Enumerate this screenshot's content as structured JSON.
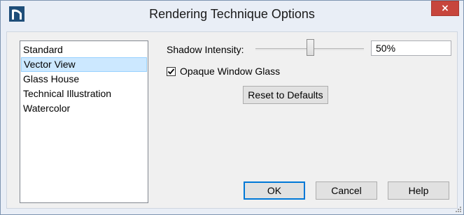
{
  "window": {
    "title": "Rendering Technique Options",
    "close_label": "×",
    "accent_color": "#1f4e79"
  },
  "technique_list": {
    "items": [
      {
        "label": "Standard",
        "selected": false
      },
      {
        "label": "Vector View",
        "selected": true
      },
      {
        "label": "Glass House",
        "selected": false
      },
      {
        "label": "Technical Illustration",
        "selected": false
      },
      {
        "label": "Watercolor",
        "selected": false
      }
    ]
  },
  "shadow": {
    "label": "Shadow Intensity:",
    "value_text": "50%",
    "slider_fraction": 0.5
  },
  "opaque_glass": {
    "label": "Opaque Window Glass",
    "checked": true
  },
  "buttons": {
    "reset": "Reset to Defaults",
    "ok": "OK",
    "cancel": "Cancel",
    "help": "Help"
  },
  "icons": {
    "app": "app-logo-icon",
    "close": "close-icon",
    "check": "checkmark-icon",
    "grip": "resize-grip-icon"
  }
}
